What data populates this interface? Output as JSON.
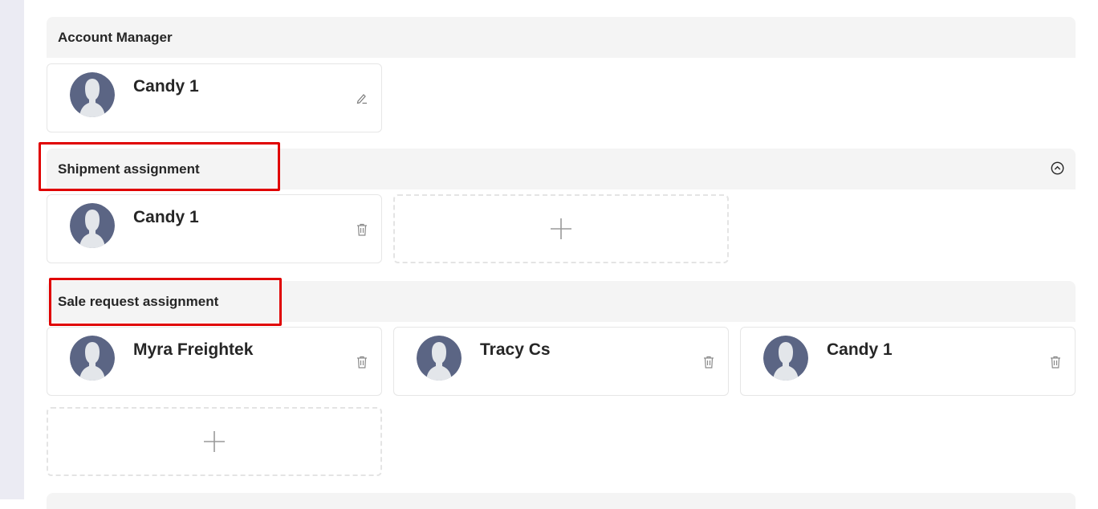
{
  "sections": {
    "account_manager": {
      "title": "Account Manager",
      "members": [
        {
          "name": "Candy 1",
          "action_icon": "edit-icon"
        }
      ]
    },
    "shipment": {
      "title": "Shipment assignment",
      "collapse_icon": "chevron-up-circle-icon",
      "members": [
        {
          "name": "Candy 1",
          "action_icon": "trash-icon"
        }
      ],
      "add_icon": "plus-icon"
    },
    "sale_request": {
      "title": "Sale request assignment",
      "members": [
        {
          "name": "Myra Freightek",
          "action_icon": "trash-icon"
        },
        {
          "name": "Tracy Cs",
          "action_icon": "trash-icon"
        },
        {
          "name": "Candy 1",
          "action_icon": "trash-icon"
        }
      ],
      "add_icon": "plus-icon"
    }
  },
  "colors": {
    "highlight": "#e00000",
    "avatar_bg": "#5b6584",
    "section_bg": "#f4f4f4",
    "rail_bg": "#ebebf3"
  }
}
